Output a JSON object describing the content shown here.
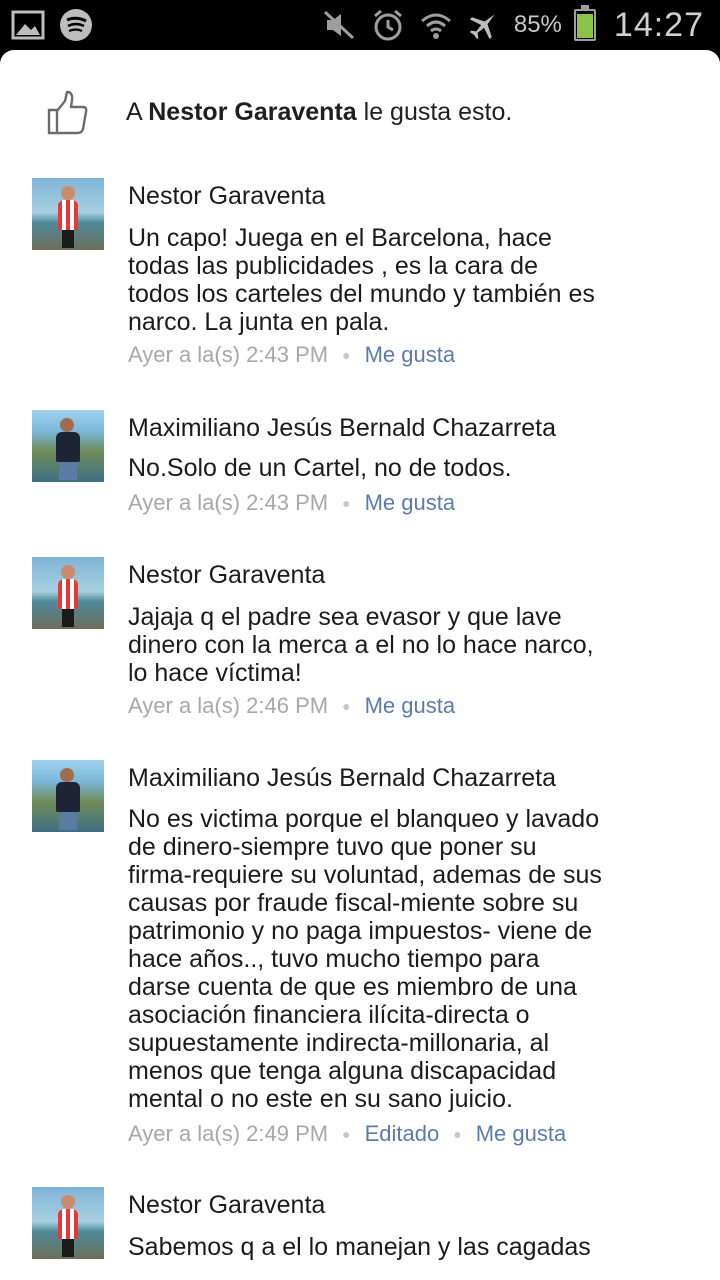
{
  "status_bar": {
    "left_icons": [
      "gallery-icon",
      "spotify-icon"
    ],
    "right_icons": [
      "mute-icon",
      "alarm-icon",
      "wifi-icon",
      "airplane-icon"
    ],
    "battery_percent": "85%",
    "battery_level": 0.85,
    "time": "14:27"
  },
  "likes": {
    "prefix": "A ",
    "name": "Nestor Garaventa",
    "suffix": " le gusta esto."
  },
  "comments": [
    {
      "author": "Nestor Garaventa",
      "lines": [
        "Un capo! Juega en el Barcelona, hace",
        "todas las publicidades , es la cara de",
        "todos los carteles del mundo y también es",
        "narco. La junta en pala."
      ],
      "time": "Ayer a la(s) 2:43 PM",
      "like_label": "Me gusta"
    },
    {
      "author": "Maximiliano Jesús Bernald Chazarreta",
      "lines": [
        "No.Solo de un Cartel, no de todos."
      ],
      "time": "Ayer a la(s) 2:43 PM",
      "like_label": "Me gusta"
    },
    {
      "author": "Nestor Garaventa",
      "lines": [
        "Jajaja q el padre sea evasor y que lave",
        "dinero con la merca a el no lo hace narco,",
        "lo hace víctima!"
      ],
      "time": "Ayer a la(s) 2:46 PM",
      "like_label": "Me gusta"
    },
    {
      "author": "Maximiliano Jesús Bernald Chazarreta",
      "lines": [
        "No es victima porque el blanqueo y lavado",
        "de dinero-siempre tuvo que poner su",
        "firma-requiere su voluntad, ademas de sus",
        "causas por fraude fiscal-miente sobre su",
        "patrimonio y no paga impuestos- viene de",
        "hace años.., tuvo mucho tiempo para",
        "darse cuenta de que es miembro de una",
        "asociación financiera ilícita-directa o",
        "supuestamente indirecta-millonaria, al",
        "menos que tenga alguna discapacidad",
        "mental o no este en su sano juicio."
      ],
      "time": "Ayer a la(s) 2:49 PM",
      "edited_label": "Editado",
      "like_label": "Me gusta"
    },
    {
      "author": "Nestor Garaventa",
      "lines": [
        "Sabemos q a el lo manejan y las cagadas"
      ]
    }
  ]
}
